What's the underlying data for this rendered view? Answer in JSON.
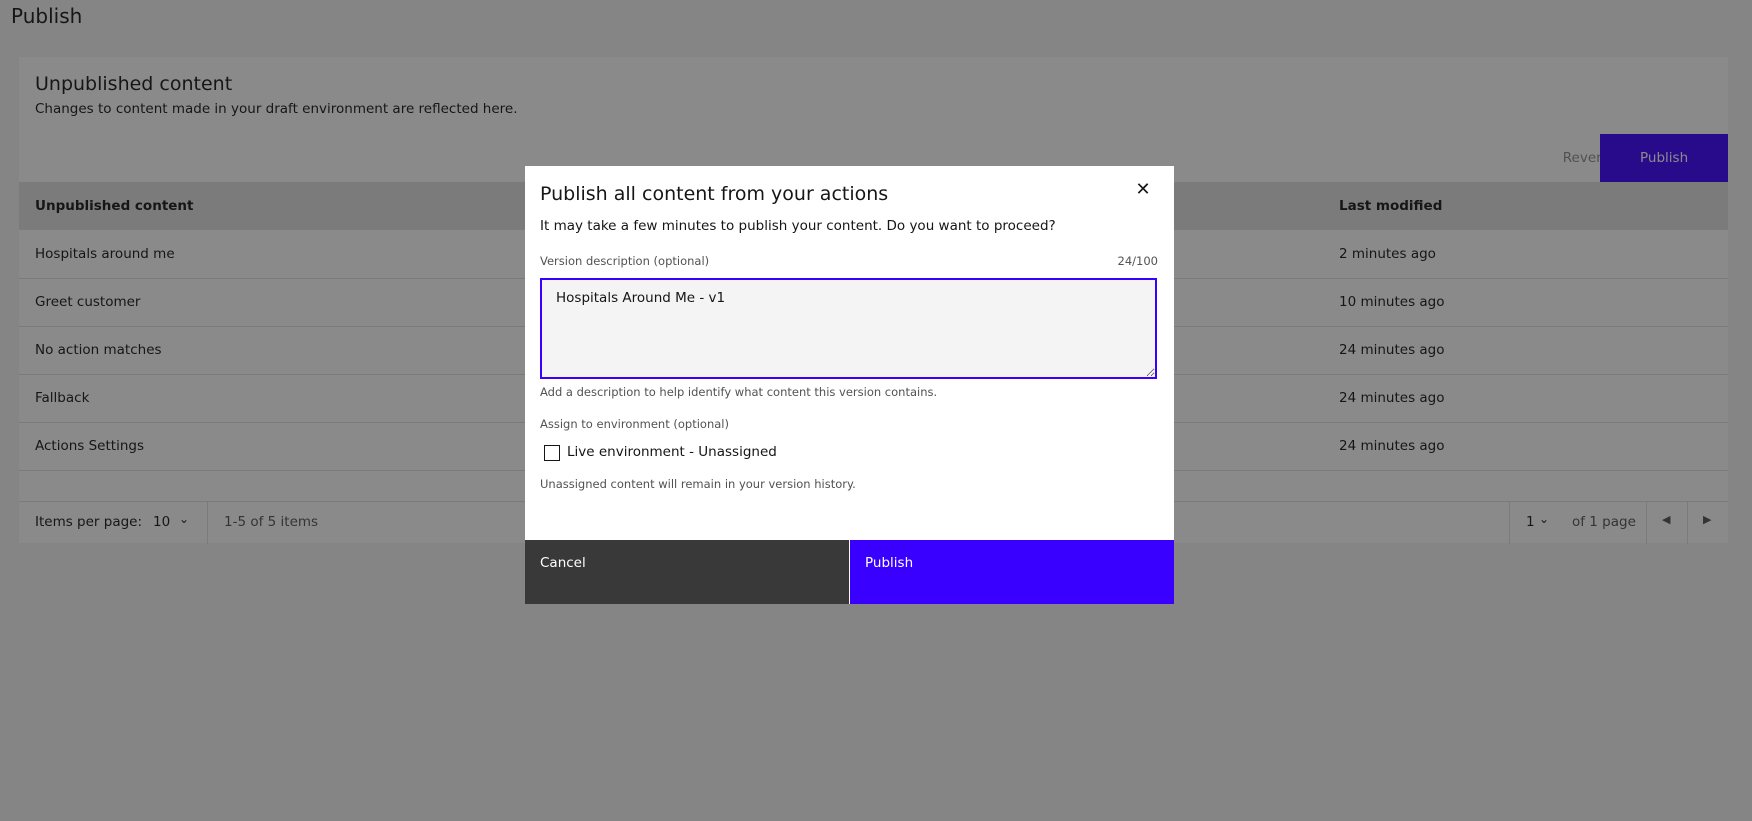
{
  "page": {
    "title": "Publish"
  },
  "panel": {
    "title": "Unpublished content",
    "subtitle": "Changes to content made in your draft environment are reflected here.",
    "revert_label": "Revert",
    "publish_label": "Publish"
  },
  "table": {
    "headers": [
      "Unpublished content",
      "Last modified"
    ],
    "rows": [
      {
        "name": "Hospitals around me",
        "modified": "2 minutes ago"
      },
      {
        "name": "Greet customer",
        "modified": "10 minutes ago"
      },
      {
        "name": "No action matches",
        "modified": "24 minutes ago"
      },
      {
        "name": "Fallback",
        "modified": "24 minutes ago"
      },
      {
        "name": "Actions Settings",
        "modified": "24 minutes ago"
      }
    ]
  },
  "pagination": {
    "items_per_page_label": "Items per page:",
    "items_per_page": "10",
    "range": "1-5 of 5 items",
    "page": "1",
    "of_pages": "of 1 page"
  },
  "modal": {
    "title": "Publish all content from your actions",
    "body": "It may take a few minutes to publish your content. Do you want to proceed?",
    "version_label": "Version description (optional)",
    "char_count": "24/100",
    "version_value": "Hospitals Around Me - v1",
    "version_helper": "Add a description to help identify what content this version contains.",
    "env_label": "Assign to environment (optional)",
    "env_option": "Live environment - Unassigned",
    "env_checked": false,
    "env_helper": "Unassigned content will remain in your version history.",
    "cancel_label": "Cancel",
    "publish_label": "Publish"
  },
  "colors": {
    "primary": "#3a00ff",
    "secondary_button": "#393939",
    "overlay": "rgba(22,22,22,0.5)"
  },
  "icons": {
    "close": "close-icon",
    "chevron": "chevron-down-icon",
    "prev": "caret-left-icon",
    "next": "caret-right-icon"
  }
}
